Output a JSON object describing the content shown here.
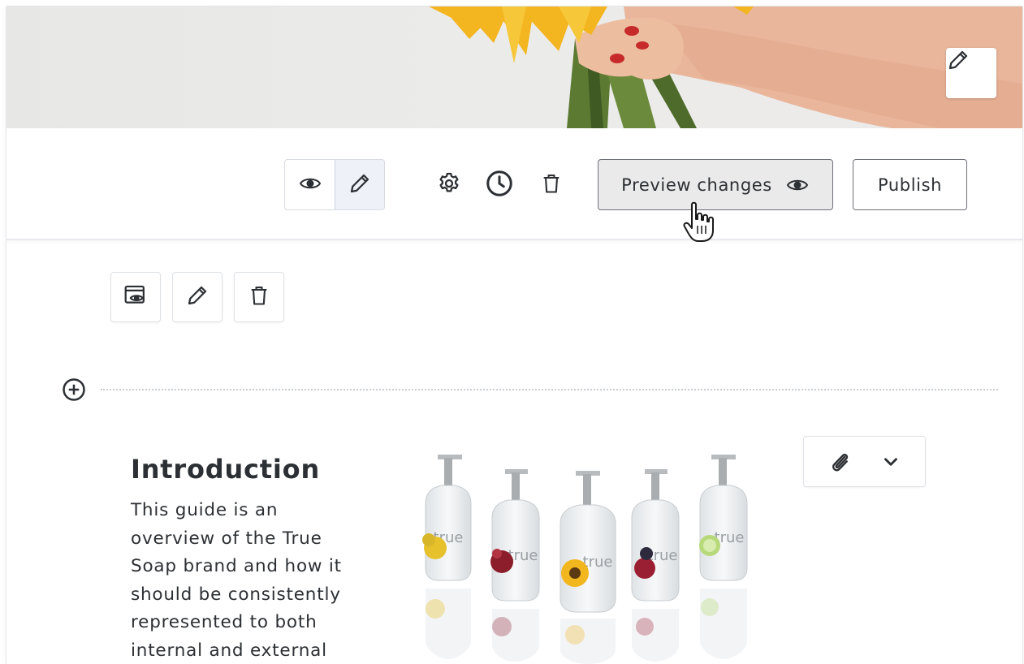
{
  "toolbar": {
    "preview_label": "Preview changes",
    "publish_label": "Publish"
  },
  "content": {
    "title": "Introduction",
    "body": "This guide is an overview of the True Soap brand and how it should be consistently represented to both internal and external"
  },
  "icons": {
    "hero_edit": "pencil-icon",
    "view_mode": "eye-icon",
    "edit_mode": "pencil-icon",
    "settings": "gear-icon",
    "history": "clock-icon",
    "delete": "trash-icon",
    "preview": "eye-icon",
    "section_preview": "preview-window-icon",
    "section_edit": "pencil-icon",
    "section_delete": "trash-icon",
    "add_block": "plus-circle-icon",
    "attach": "paperclip-icon",
    "expand": "chevron-down-icon"
  },
  "colors": {
    "text": "#2c2f33",
    "border": "#6d7077",
    "preview_bg": "#eaeaea",
    "active_mode_bg": "#eef2f8"
  }
}
